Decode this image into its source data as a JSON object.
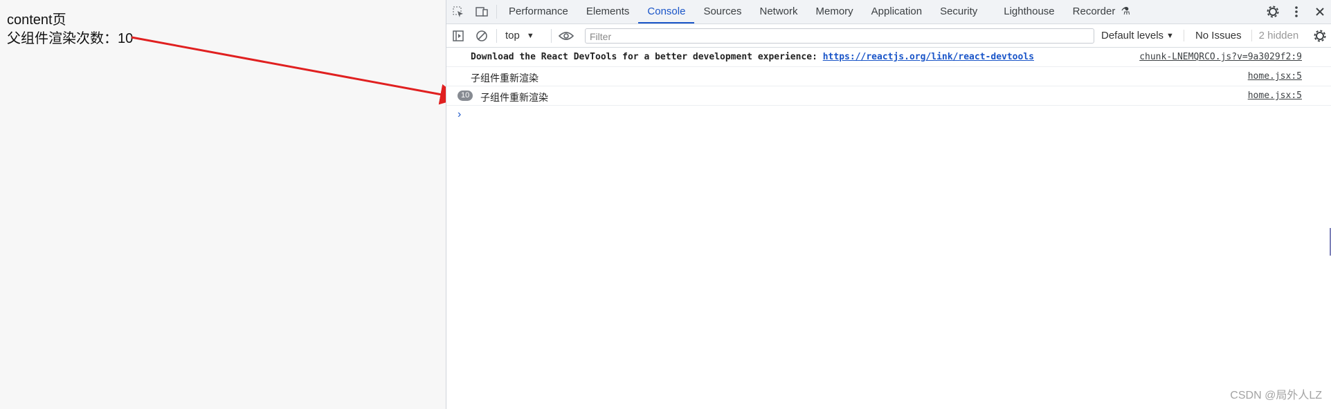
{
  "page": {
    "title": "content页",
    "render_count_text": "父组件渲染次数：10"
  },
  "devtools": {
    "tabs": [
      "Performance",
      "Elements",
      "Console",
      "Sources",
      "Network",
      "Memory",
      "Application",
      "Security",
      "Lighthouse",
      "Recorder"
    ],
    "active_tab": "Console",
    "toolbar": {
      "context": "top",
      "filter_placeholder": "Filter",
      "levels": "Default levels",
      "issues": "No Issues",
      "hidden": "2 hidden"
    },
    "messages": [
      {
        "text_prefix": "Download the React DevTools for a better development experience: ",
        "link": "https://reactjs.org/link/react-devtools",
        "source": "chunk-LNEMQRCO.js?v=9a3029f2:9"
      },
      {
        "text": "子组件重新渲染",
        "source": "home.jsx:5"
      },
      {
        "repeat": "10",
        "text": "子组件重新渲染",
        "source": "home.jsx:5"
      }
    ],
    "prompt_glyph": "›"
  },
  "watermark": "CSDN @局外人LZ",
  "colors": {
    "accent": "#1a55c8",
    "arrow": "#e02020"
  }
}
